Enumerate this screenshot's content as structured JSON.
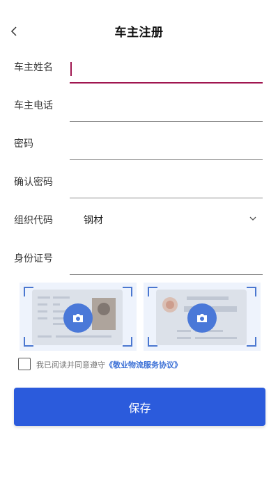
{
  "header": {
    "title": "车主注册",
    "back_icon": "chevron-left-icon"
  },
  "form": {
    "fields": [
      {
        "label": "车主姓名",
        "value": "",
        "placeholder": ""
      },
      {
        "label": "车主电话",
        "value": "",
        "placeholder": ""
      },
      {
        "label": "密码",
        "value": "",
        "placeholder": ""
      },
      {
        "label": "确认密码",
        "value": "",
        "placeholder": ""
      },
      {
        "label": "组织代码",
        "value": "钢材"
      },
      {
        "label": "身份证号",
        "value": "",
        "placeholder": ""
      }
    ]
  },
  "id_cards": {
    "front_icon": "camera-icon",
    "back_icon": "camera-icon"
  },
  "agreement": {
    "prefix": "我已阅读并同意遵守",
    "link": "《敬业物流服务协议》"
  },
  "save_label": "保存",
  "colors": {
    "accent": "#2b5bdc",
    "active_underline": "#a01650",
    "link": "#3a6fd6"
  }
}
